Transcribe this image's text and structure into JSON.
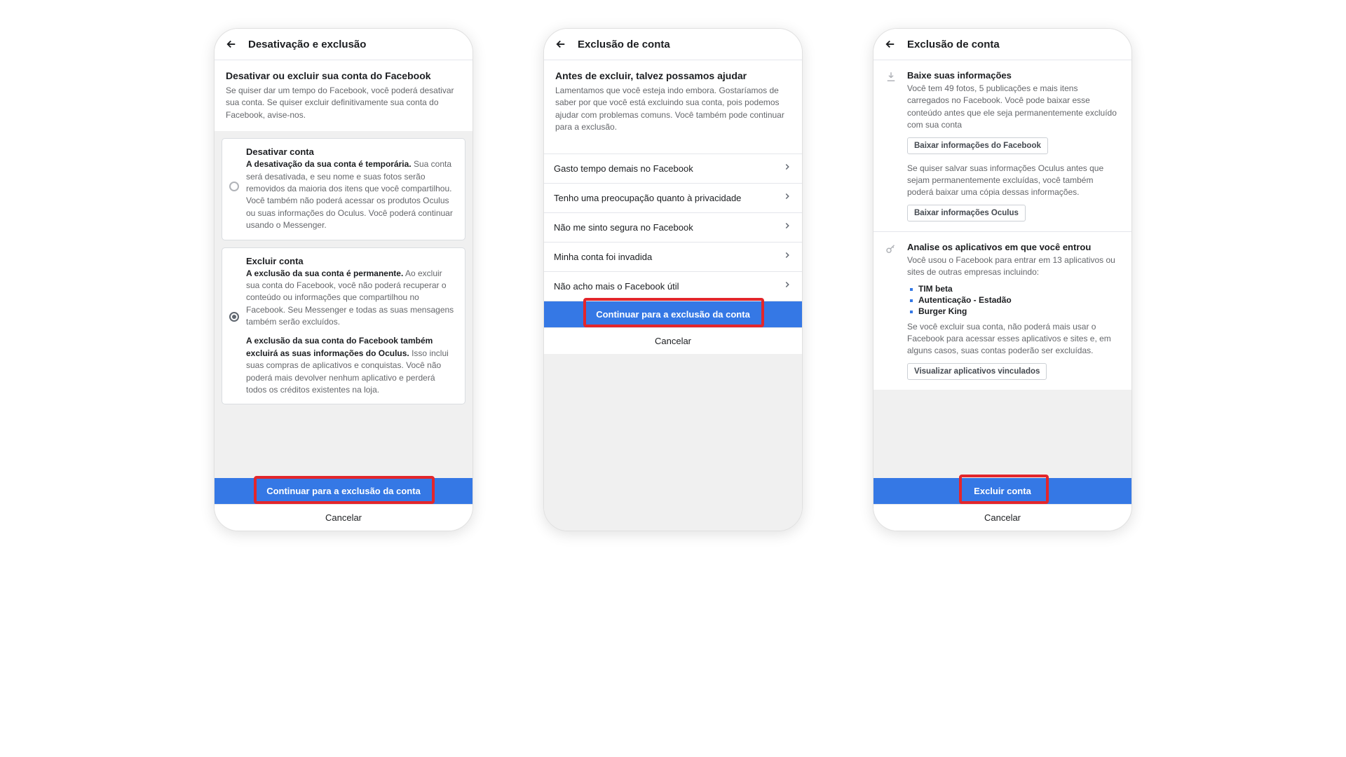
{
  "phone1": {
    "header_title": "Desativação e exclusão",
    "section_title": "Desativar ou excluir sua conta do Facebook",
    "section_desc": "Se quiser dar um tempo do Facebook, você poderá desativar sua conta. Se quiser excluir definitivamente sua conta do Facebook, avise-nos.",
    "option1": {
      "title": "Desativar conta",
      "bold1": "A desativação da sua conta é temporária.",
      "rest1": " Sua conta será desativada, e seu nome e suas fotos serão removidos da maioria dos itens que você compartilhou. Você também não poderá acessar os produtos Oculus ou suas informações do Oculus. Você poderá continuar usando o Messenger."
    },
    "option2": {
      "title": "Excluir conta",
      "bold1": "A exclusão da sua conta é permanente.",
      "rest1": " Ao excluir sua conta do Facebook, você não poderá recuperar o conteúdo ou informações que compartilhou no Facebook. Seu Messenger e todas as suas mensagens também serão excluídos.",
      "bold2": "A exclusão da sua conta do Facebook também excluirá as suas informações do Oculus.",
      "rest2": " Isso inclui suas compras de aplicativos e conquistas. Você não poderá mais devolver nenhum aplicativo e perderá todos os créditos existentes na loja."
    },
    "primary": "Continuar para a exclusão da conta",
    "cancel": "Cancelar"
  },
  "phone2": {
    "header_title": "Exclusão de conta",
    "section_title": "Antes de excluir, talvez possamos ajudar",
    "section_desc": "Lamentamos que você esteja indo embora. Gostaríamos de saber por que você está excluindo sua conta, pois podemos ajudar com problemas comuns. Você também pode continuar para a exclusão.",
    "reasons": [
      "Gasto tempo demais no Facebook",
      "Tenho uma preocupação quanto à privacidade",
      "Não me sinto segura no Facebook",
      "Minha conta foi invadida",
      "Não acho mais o Facebook útil"
    ],
    "primary": "Continuar para a exclusão da conta",
    "cancel": "Cancelar"
  },
  "phone3": {
    "header_title": "Exclusão de conta",
    "download": {
      "title": "Baixe suas informações",
      "desc": "Você tem 49 fotos, 5 publicações e mais itens carregados no Facebook. Você pode baixar esse conteúdo antes que ele seja permanentemente excluído com sua conta",
      "btn1": "Baixar informações do Facebook",
      "desc2": "Se quiser salvar suas informações Oculus antes que sejam permanentemente excluídas, você também poderá baixar uma cópia dessas informações.",
      "btn2": "Baixar informações Oculus"
    },
    "apps": {
      "title": "Analise os aplicativos em que você entrou",
      "desc": "Você usou o Facebook para entrar em 13 aplicativos ou sites de outras empresas incluindo:",
      "list": [
        "TIM beta",
        "Autenticação - Estadão",
        "Burger King"
      ],
      "desc2": "Se você excluir sua conta, não poderá mais usar o Facebook para acessar esses aplicativos e sites e, em alguns casos, suas contas poderão ser excluídas.",
      "btn": "Visualizar aplicativos vinculados"
    },
    "primary": "Excluir conta",
    "cancel": "Cancelar"
  }
}
